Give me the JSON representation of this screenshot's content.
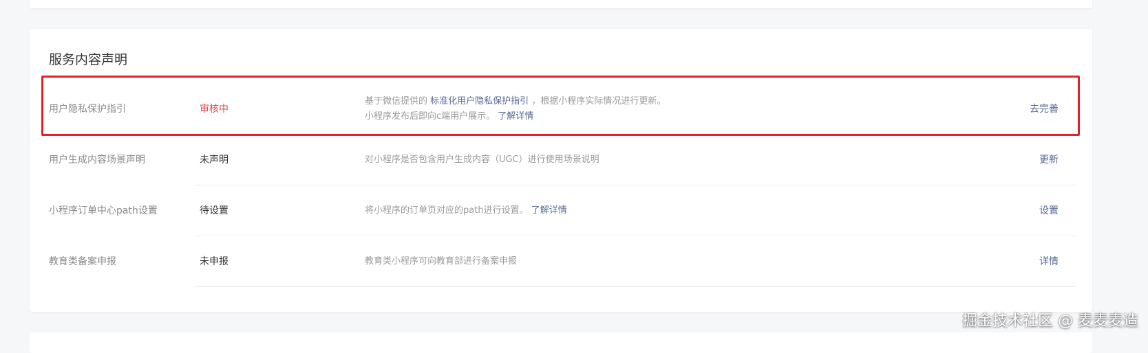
{
  "section": {
    "title": "服务内容声明"
  },
  "rows": [
    {
      "name": "用户隐私保护指引",
      "status": "审核中",
      "desc_line1_prefix": "基于微信提供的",
      "desc_line1_link": "标准化用户隐私保护指引",
      "desc_line1_suffix": "，根据小程序实际情况进行更新。",
      "desc_line2_prefix": "小程序发布后即向c端用户展示。",
      "desc_line2_link": "了解详情",
      "action": "去完善"
    },
    {
      "name": "用户生成内容场景声明",
      "status": "未声明",
      "desc": "对小程序是否包含用户生成内容（UGC）进行使用场景说明",
      "action": "更新"
    },
    {
      "name": "小程序订单中心path设置",
      "status": "待设置",
      "desc_prefix": "将小程序的订单页对应的path进行设置。",
      "desc_link": "了解详情",
      "action": "设置"
    },
    {
      "name": "教育类备案申报",
      "status": "未申报",
      "desc": "教育类小程序可向教育部进行备案申报",
      "action": "详情"
    }
  ],
  "watermark": "掘金技术社区 @ 麦麦麦造",
  "colors": {
    "page_bg": "#f6f7f9",
    "link": "#576b95",
    "status_review": "#e5484d",
    "highlight_border": "#e5202a"
  }
}
